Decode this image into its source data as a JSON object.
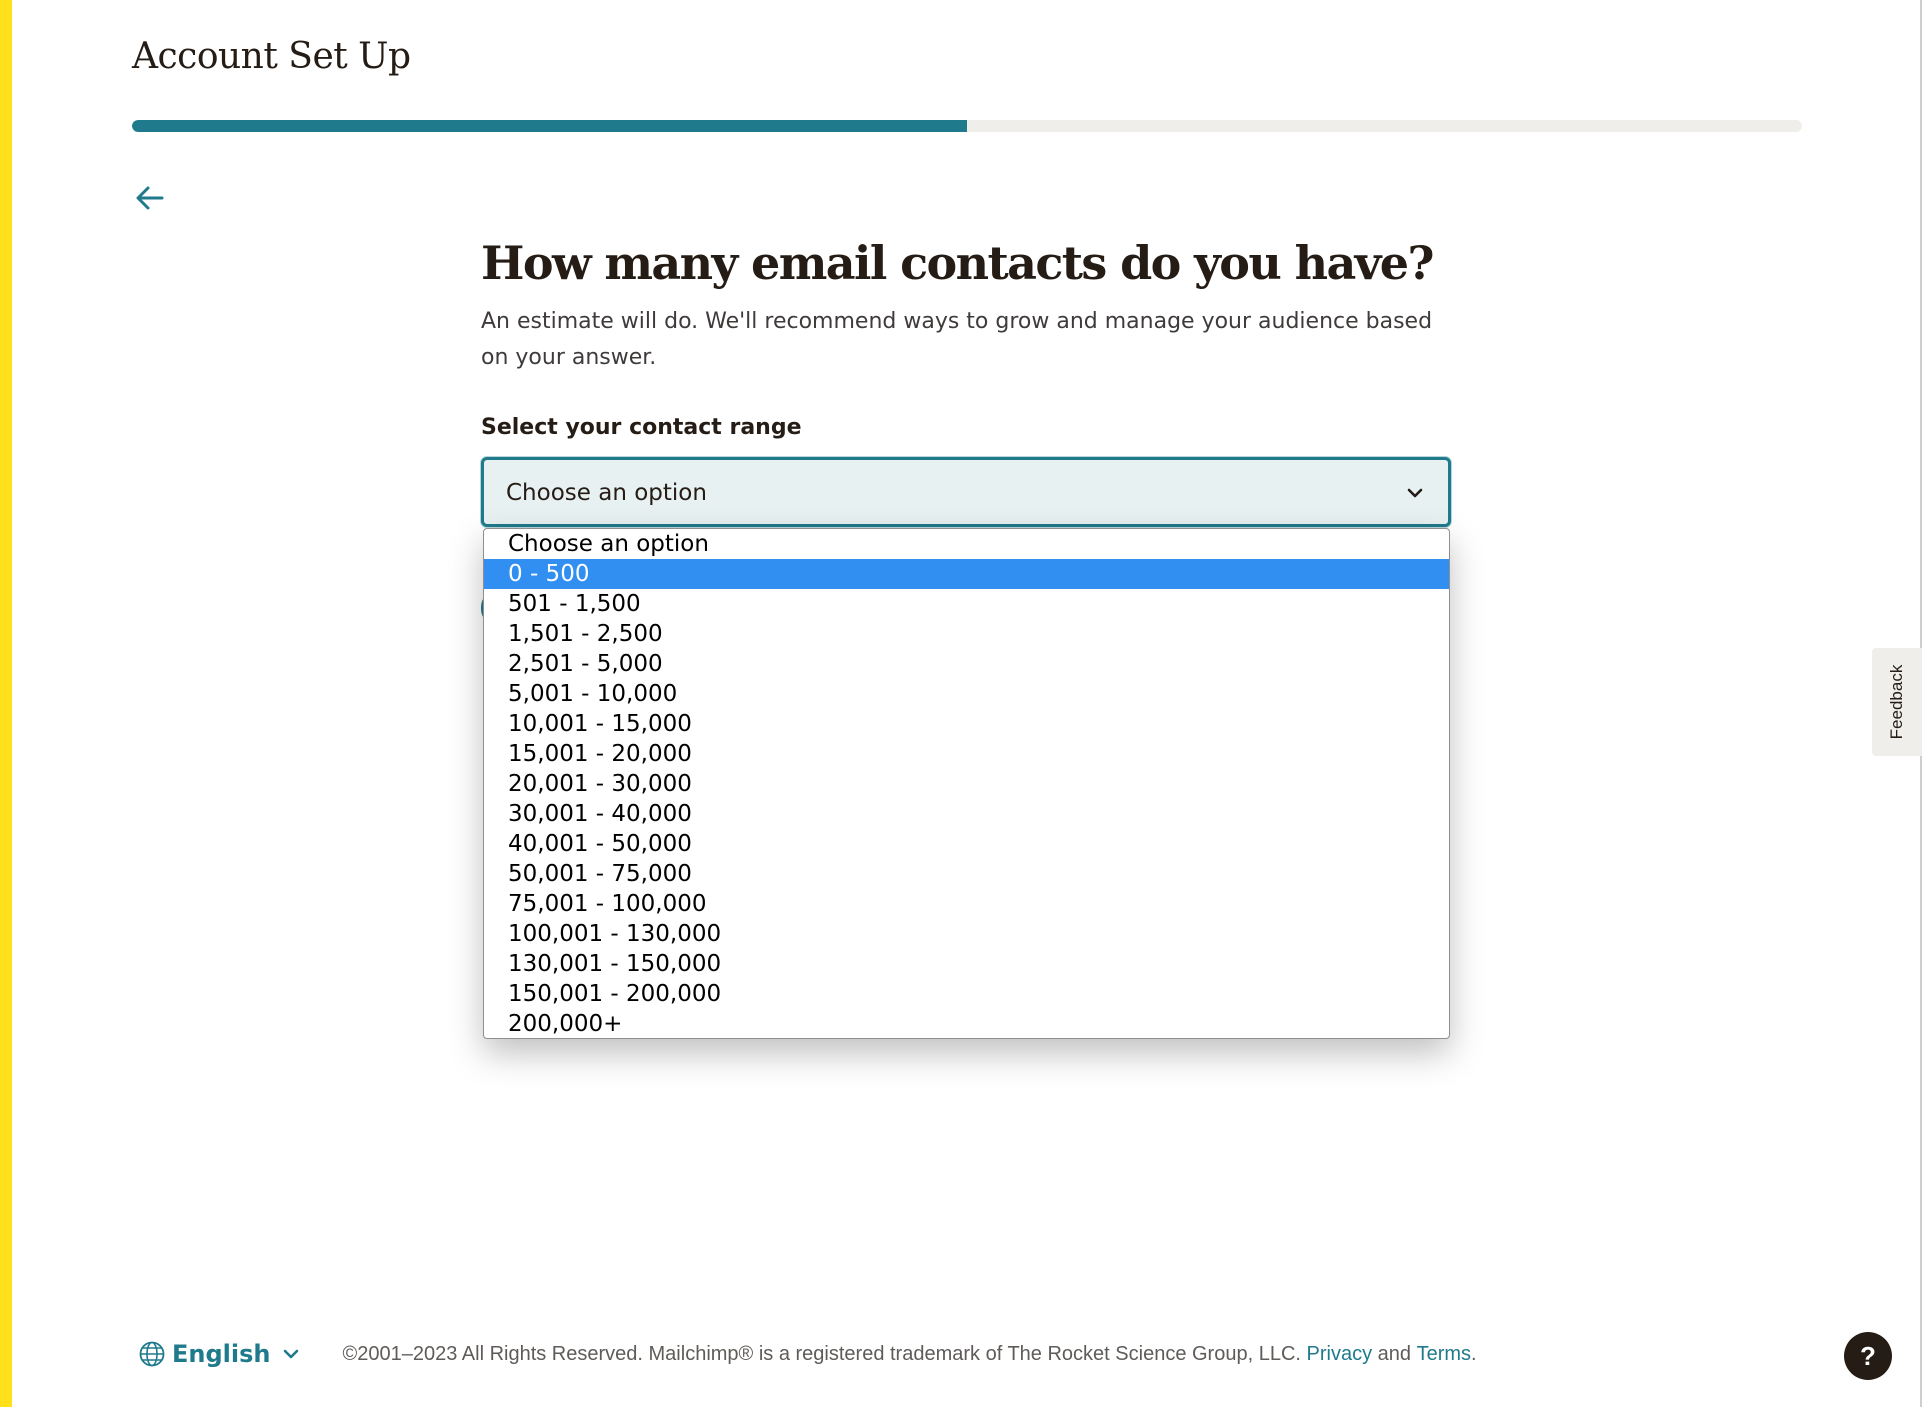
{
  "header": {
    "title": "Account Set Up"
  },
  "progress": {
    "fraction": 0.5,
    "color": "#1f7a8c"
  },
  "back": {
    "icon": "arrow-left-icon"
  },
  "main": {
    "question": "How many email contacts do you have?",
    "subtitle": "An estimate will do. We'll recommend ways to grow and manage your audience based on your answer.",
    "field_label": "Select your contact range",
    "select": {
      "current_value": "Choose an option",
      "chevron_icon": "chevron-down-icon",
      "options": [
        "Choose an option",
        "0 - 500",
        "501 - 1,500",
        "1,501 - 2,500",
        "2,501 - 5,000",
        "5,001 - 10,000",
        "10,001 - 15,000",
        "15,001 - 20,000",
        "20,001 - 30,000",
        "30,001 - 40,000",
        "40,001 - 50,000",
        "50,001 - 75,000",
        "75,001 - 100,000",
        "100,001 - 130,000",
        "130,001 - 150,000",
        "150,001 - 200,000",
        "200,000+"
      ],
      "highlighted_option": "0 - 500"
    }
  },
  "feedback": {
    "label": "Feedback"
  },
  "footer": {
    "language": "English",
    "globe_icon": "globe-icon",
    "copyright": "©2001–2023 All Rights Reserved. Mailchimp® is a registered trademark of The Rocket Science Group, LLC.",
    "privacy_link": "Privacy",
    "and_text": "and",
    "terms_link": "Terms",
    "period": "."
  },
  "help": {
    "label": "?"
  },
  "colors": {
    "accent": "#1f7a8c",
    "brand_yellow": "#ffe01b",
    "option_highlight": "#308ff0",
    "text": "#241c15"
  }
}
